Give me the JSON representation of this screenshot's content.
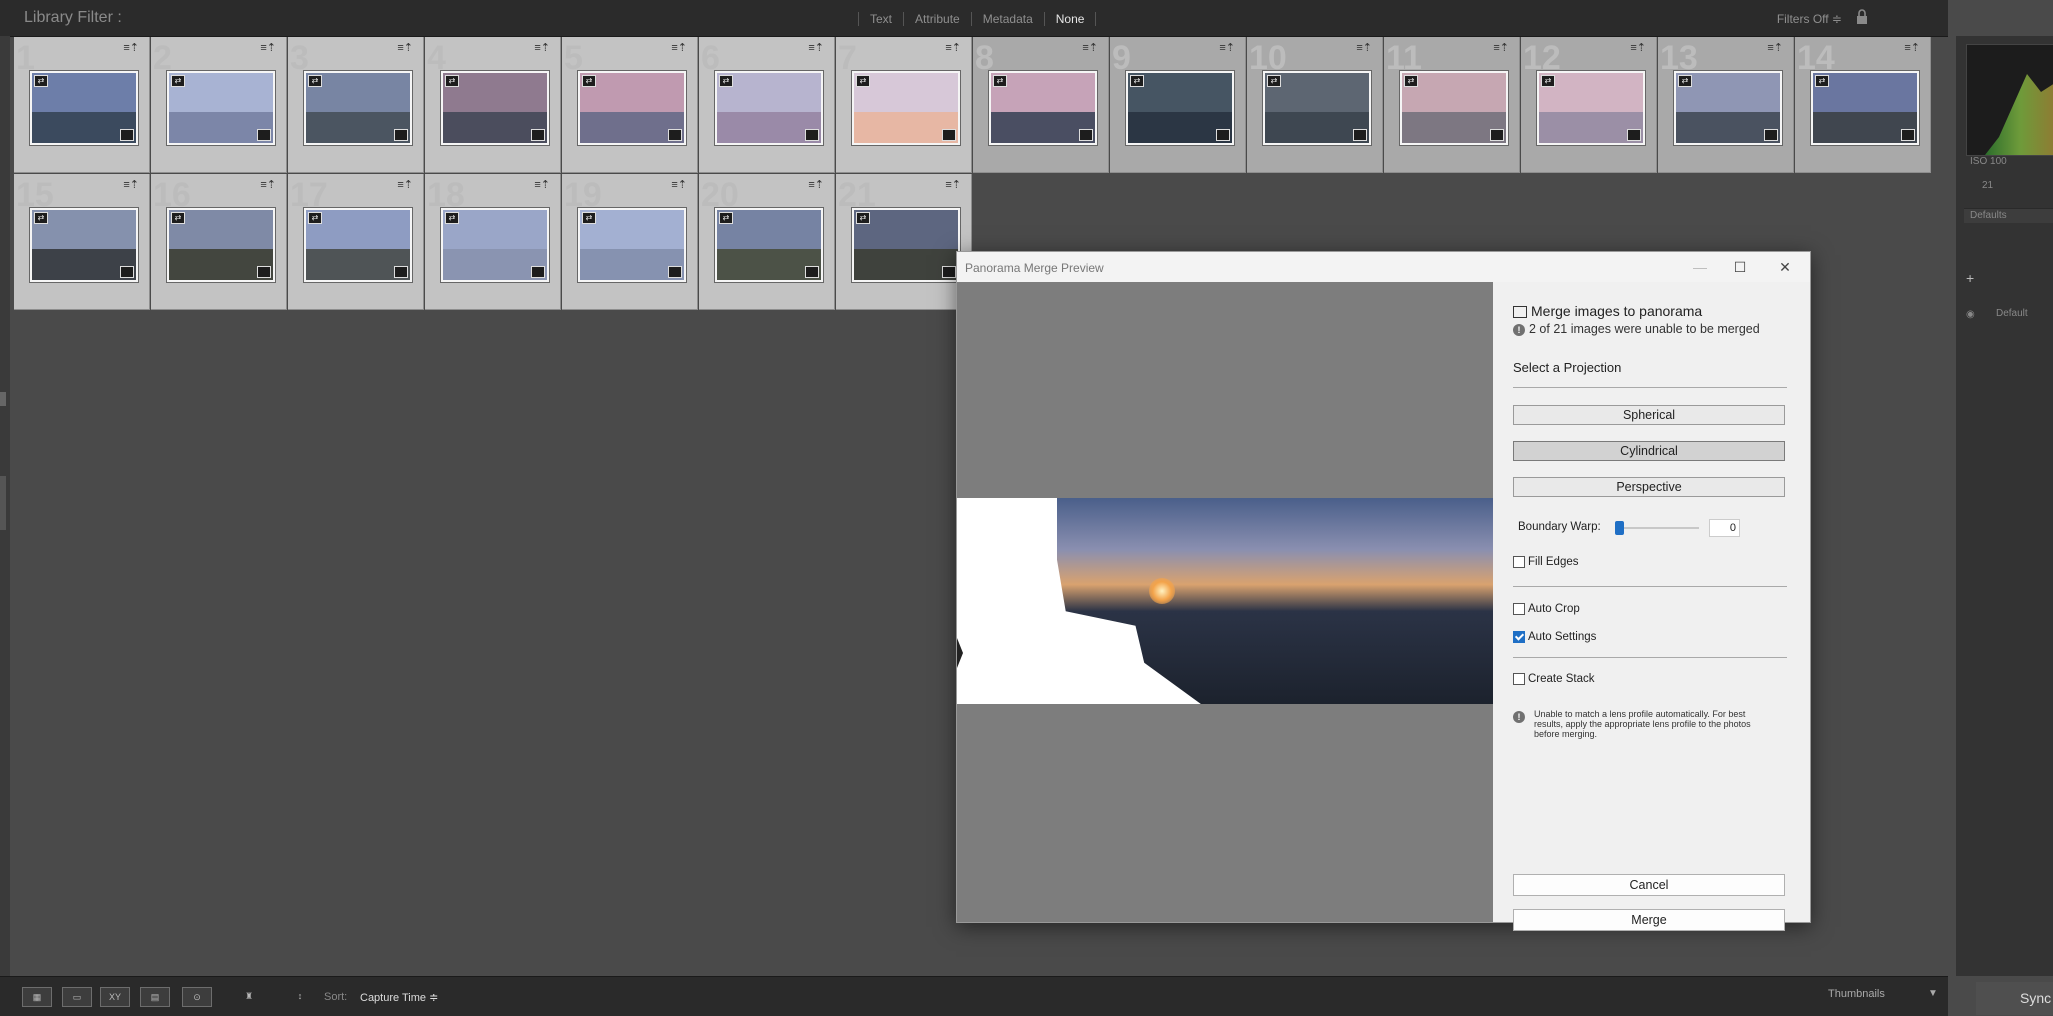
{
  "filter_bar": {
    "title": "Library Filter :",
    "tabs": [
      "Text",
      "Attribute",
      "Metadata",
      "None"
    ],
    "active_tab": "None",
    "filters_label": "Filters Off ≑"
  },
  "grid": {
    "badge": "≡⇡",
    "cells": [
      {
        "num": "1",
        "sky": "#6d7ea9",
        "land": "#3b4a5e",
        "selected": true
      },
      {
        "num": "2",
        "sky": "#a8b3d3",
        "land": "#7c86a8",
        "selected": true
      },
      {
        "num": "3",
        "sky": "#7885a3",
        "land": "#4b5561",
        "selected": true
      },
      {
        "num": "4",
        "sky": "#8f7a8f",
        "land": "#4b4d5d",
        "selected": true
      },
      {
        "num": "5",
        "sky": "#c09ab0",
        "land": "#6f6f8c",
        "selected": true
      },
      {
        "num": "6",
        "sky": "#b7b4cf",
        "land": "#9a8aa8",
        "selected": true
      },
      {
        "num": "7",
        "sky": "#d7c8d8",
        "land": "#e7b7a4",
        "selected": true
      },
      {
        "num": "8",
        "sky": "#c6a3b8",
        "land": "#4a4e62",
        "selected": false
      },
      {
        "num": "9",
        "sky": "#465563",
        "land": "#2b3644",
        "selected": false
      },
      {
        "num": "10",
        "sky": "#5d6672",
        "land": "#3e4751",
        "selected": false
      },
      {
        "num": "11",
        "sky": "#c6a7b2",
        "land": "#7d7782",
        "selected": false
      },
      {
        "num": "12",
        "sky": "#d2b4c3",
        "land": "#9b8fa6",
        "selected": false
      },
      {
        "num": "13",
        "sky": "#8f96b4",
        "land": "#4a5260",
        "selected": false
      },
      {
        "num": "14",
        "sky": "#6a76a0",
        "land": "#40464f",
        "selected": false
      },
      {
        "num": "15",
        "sky": "#8591ad",
        "land": "#3d4148",
        "selected": true
      },
      {
        "num": "16",
        "sky": "#7f8aa6",
        "land": "#43463f",
        "selected": true
      },
      {
        "num": "17",
        "sky": "#8e9cc2",
        "land": "#4f5456",
        "selected": true
      },
      {
        "num": "18",
        "sky": "#9aa6c8",
        "land": "#8a94b1",
        "selected": true
      },
      {
        "num": "19",
        "sky": "#a3b0d2",
        "land": "#8692b0",
        "selected": true
      },
      {
        "num": "20",
        "sky": "#7683a3",
        "land": "#4c5247",
        "selected": true
      },
      {
        "num": "21",
        "sky": "#5d6680",
        "land": "#3f423d",
        "selected": true
      }
    ]
  },
  "dialog": {
    "title": "Panorama Merge Preview",
    "window_buttons": {
      "minimize": "—",
      "maximize": "☐",
      "close": "✕"
    },
    "heading": "Merge images to panorama",
    "warning": "2 of 21 images were unable to be merged",
    "projection_label": "Select a Projection",
    "projections": [
      "Spherical",
      "Cylindrical",
      "Perspective"
    ],
    "selected_projection": "Cylindrical",
    "boundary_warp_label": "Boundary Warp:",
    "boundary_warp_value": "0",
    "fill_edges": {
      "label": "Fill Edges",
      "checked": false
    },
    "auto_crop": {
      "label": "Auto Crop",
      "checked": false
    },
    "auto_settings": {
      "label": "Auto Settings",
      "checked": true
    },
    "create_stack": {
      "label": "Create Stack",
      "checked": false
    },
    "lens_note": "Unable to match a lens profile automatically. For best results, apply the appropriate lens profile to the photos before merging.",
    "cancel_label": "Cancel",
    "merge_label": "Merge"
  },
  "right_panel": {
    "iso": "ISO 100",
    "count": "21",
    "defaults": "Defaults",
    "default": "Default",
    "add": "+"
  },
  "bottom_bar": {
    "view_labels": [
      "▦",
      "▭",
      "XY",
      "▤",
      "⊙"
    ],
    "sort_label": "Sort:",
    "sort_value": "Capture Time ≑",
    "thumbnails_label": "Thumbnails",
    "sync_label": "Sync"
  },
  "colors": {
    "accent": "#1f6fc5",
    "dialog_bg": "#f0f0f0",
    "app_bg": "#4a4a4a"
  }
}
